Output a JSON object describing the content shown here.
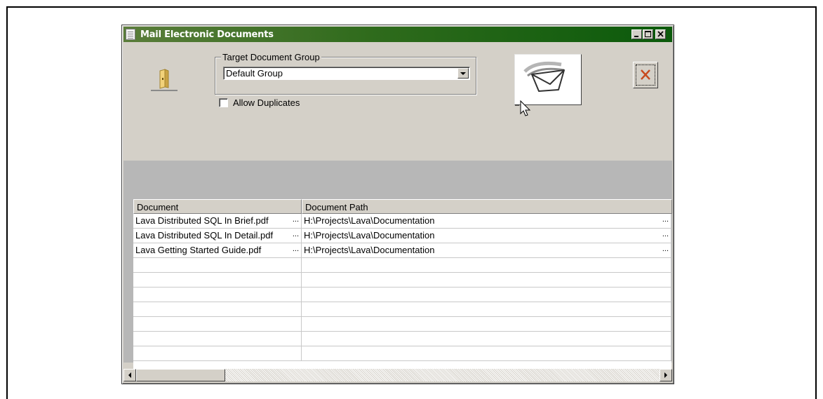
{
  "window": {
    "title": "Mail Electronic Documents",
    "titlebar_colors": [
      "#5a7d3a",
      "#0b5a0b"
    ]
  },
  "toolbar": {
    "folder_icon": "folder-icon",
    "group_box_label": "Target Document Group",
    "group_selected": "Default Group",
    "allow_duplicates_label": "Allow Duplicates",
    "allow_duplicates_checked": false,
    "mail_icon": "envelope-icon",
    "close_icon": "close-x-icon"
  },
  "grid": {
    "columns": [
      "Document",
      "Document Path"
    ],
    "rows": [
      {
        "document": "Lava Distributed SQL In Brief.pdf",
        "path": "H:\\Projects\\Lava\\Documentation"
      },
      {
        "document": "Lava Distributed SQL In Detail.pdf",
        "path": "H:\\Projects\\Lava\\Documentation"
      },
      {
        "document": "Lava Getting Started Guide.pdf",
        "path": "H:\\Projects\\Lava\\Documentation"
      }
    ],
    "ellipsis": "...",
    "empty_rows": 7
  }
}
